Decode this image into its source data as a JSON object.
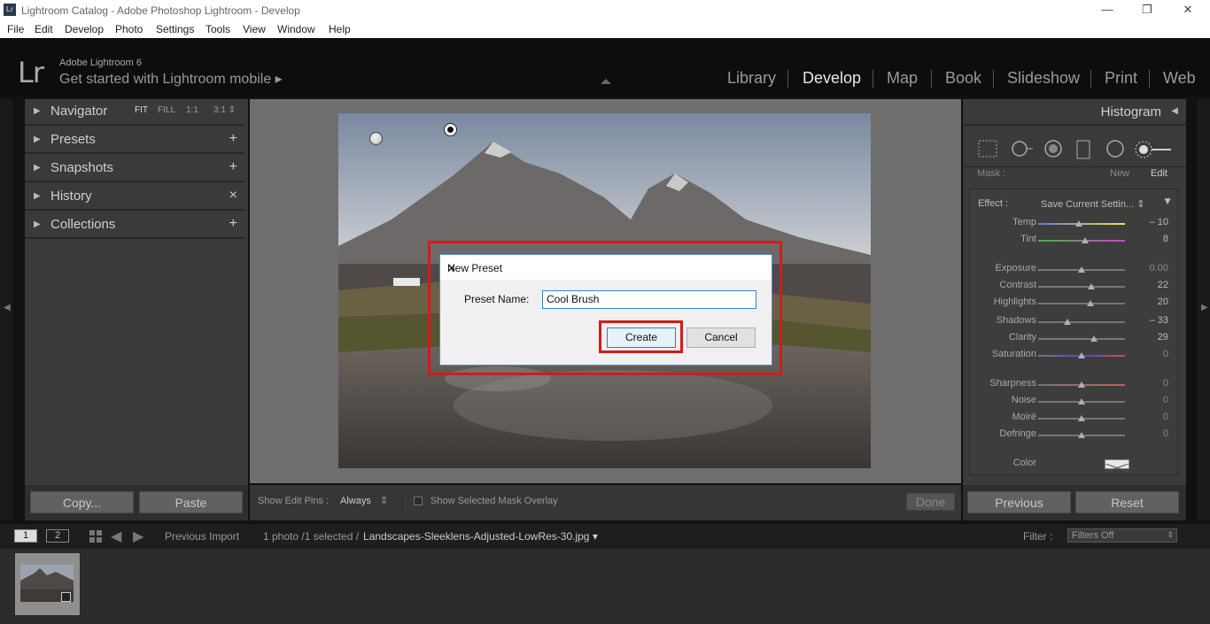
{
  "window": {
    "badge": "Lr",
    "title": "Lightroom Catalog - Adobe Photoshop Lightroom - Develop",
    "minimize": "—",
    "restore": "❐",
    "close": "✕"
  },
  "menu": [
    "File",
    "Edit",
    "Develop",
    "Photo",
    "Settings",
    "Tools",
    "View",
    "Window",
    "Help"
  ],
  "identity": {
    "logo": "Lr",
    "product": "Adobe Lightroom 6",
    "mobile": "Get started with Lightroom mobile ▸"
  },
  "modules": [
    {
      "label": "Library",
      "active": false
    },
    {
      "label": "Develop",
      "active": true
    },
    {
      "label": "Map",
      "active": false
    },
    {
      "label": "Book",
      "active": false
    },
    {
      "label": "Slideshow",
      "active": false
    },
    {
      "label": "Print",
      "active": false
    },
    {
      "label": "Web",
      "active": false
    }
  ],
  "left_panel": {
    "navigator": {
      "label": "Navigator",
      "options": [
        "FIT",
        "FILL",
        "1:1",
        "3:1 ⇕"
      ]
    },
    "presets": {
      "label": "Presets",
      "action": "+"
    },
    "snapshots": {
      "label": "Snapshots",
      "action": "+"
    },
    "history": {
      "label": "History",
      "action": "×"
    },
    "collections": {
      "label": "Collections",
      "action": "+"
    },
    "copy_button": "Copy...",
    "paste_button": "Paste"
  },
  "dialog": {
    "title": "New Preset",
    "close": "✕",
    "name_label": "Preset Name:",
    "name_value": "Cool Brush",
    "create": "Create",
    "cancel": "Cancel"
  },
  "right_panel": {
    "histogram_label": "Histogram",
    "mask_label": "Mask :",
    "mask_new": "New",
    "mask_edit": "Edit",
    "effect_label": "Effect :",
    "effect_value": "Save Current Settin... ⇕",
    "sliders": {
      "temp": {
        "label": "Temp",
        "value": "– 10",
        "pos": 0.47
      },
      "tint": {
        "label": "Tint",
        "value": "8",
        "pos": 0.54
      },
      "exposure": {
        "label": "Exposure",
        "value": "0.00",
        "pos": 0.5
      },
      "contrast": {
        "label": "Contrast",
        "value": "22",
        "pos": 0.61
      },
      "highlights": {
        "label": "Highlights",
        "value": "20",
        "pos": 0.6
      },
      "shadows": {
        "label": "Shadows",
        "value": "– 33",
        "pos": 0.34
      },
      "clarity": {
        "label": "Clarity",
        "value": "29",
        "pos": 0.64
      },
      "saturation": {
        "label": "Saturation",
        "value": "0",
        "pos": 0.5
      },
      "sharpness": {
        "label": "Sharpness",
        "value": "0",
        "pos": 0.5
      },
      "noise": {
        "label": "Noise",
        "value": "0",
        "pos": 0.5
      },
      "moire": {
        "label": "Moiré",
        "value": "0",
        "pos": 0.5
      },
      "defringe": {
        "label": "Defringe",
        "value": "0",
        "pos": 0.5
      }
    },
    "color_label": "Color",
    "previous_button": "Previous",
    "reset_button": "Reset"
  },
  "toolbar": {
    "pins_label": "Show Edit Pins :",
    "pins_value": "Always",
    "pins_arrow": "⇕",
    "overlay_label": "Show Selected Mask Overlay",
    "done": "Done"
  },
  "filmstrip_bar": {
    "page1": "1",
    "page2": "2",
    "source": "Previous Import",
    "count": "1 photo /1 selected /",
    "filename": "Landscapes-Sleeklens-Adjusted-LowRes-30.jpg ▾",
    "filter_label": "Filter :",
    "filter_value": "Filters Off"
  },
  "colors": {
    "accent_red": "#d21b1b",
    "dialog_border": "#3d7fd1"
  }
}
